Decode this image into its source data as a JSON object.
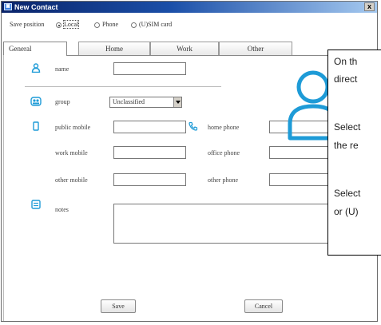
{
  "window": {
    "title": "New Contact",
    "app_icon": "contact-app-icon",
    "close_label": "x"
  },
  "save_position": {
    "label": "Save position",
    "options": [
      "Local",
      "Phone",
      "(U)SIM card"
    ],
    "selected": "Local"
  },
  "tabs": [
    "General",
    "Home",
    "Work",
    "Other"
  ],
  "active_tab": "General",
  "form": {
    "name_label": "name",
    "group_label": "group",
    "group_value": "Unclassified",
    "public_mobile_label": "public mobile",
    "home_phone_label": "home phone",
    "work_mobile_label": "work mobile",
    "office_phone_label": "office phone",
    "other_mobile_label": "other mobile",
    "other_phone_label": "other phone",
    "notes_label": "notes"
  },
  "buttons": {
    "save": "Save",
    "cancel": "Cancel"
  },
  "callout": {
    "line1": "On th",
    "line2": "direct",
    "line3": "Select",
    "line4": "the re",
    "line5": "Select",
    "line6": "or (U)"
  },
  "colors": {
    "accent": "#1e9bd7",
    "titlebar": "#0a246a"
  }
}
